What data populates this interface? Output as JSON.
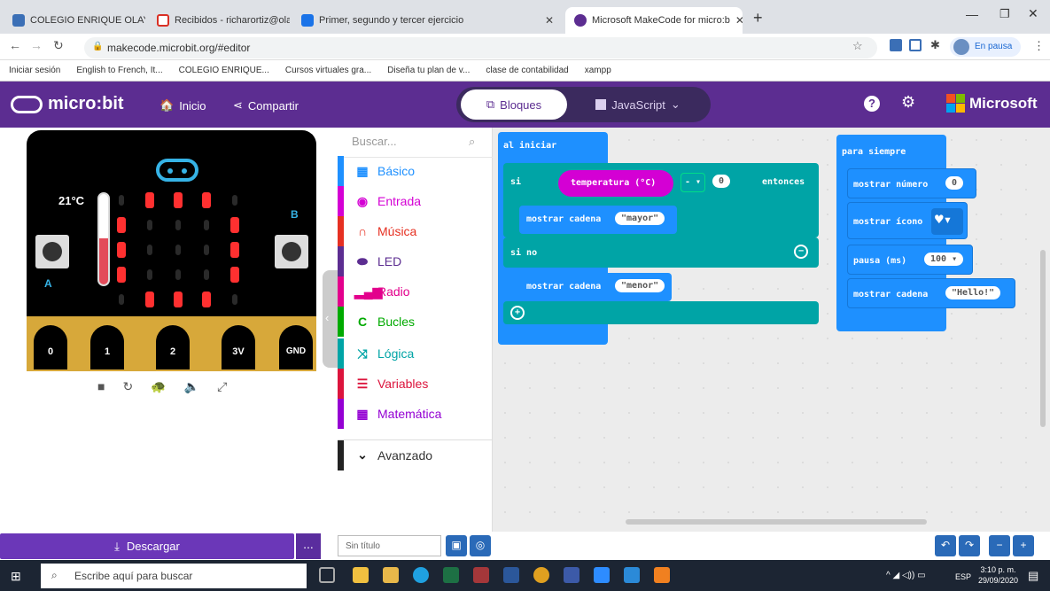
{
  "browser": {
    "tabs": [
      {
        "title": "COLEGIO ENRIQUE OLAYA HERR",
        "color": "#3b6fb6"
      },
      {
        "title": "Recibidos - richarortiz@olayista.",
        "color": "#d93025"
      },
      {
        "title": "Primer, segundo y tercer ejercicio",
        "color": "#1a73e8"
      },
      {
        "title": "Microsoft MakeCode for micro:b",
        "color": "#5c2d91"
      }
    ],
    "new_tab": "+",
    "url": "makecode.microbit.org/#editor",
    "profile": "En pausa",
    "bookmarks": [
      "Iniciar sesión",
      "English to French, It...",
      "COLEGIO ENRIQUE...",
      "Cursos virtuales gra...",
      "Diseña tu plan de v...",
      "clase de contabilidad",
      "xampp"
    ]
  },
  "header": {
    "logo": "micro:bit",
    "home": "Inicio",
    "share": "Compartir",
    "blocks": "Bloques",
    "javascript": "JavaScript",
    "brand": "Microsoft"
  },
  "simulator": {
    "temp": "21°C",
    "pins": [
      "0",
      "1",
      "2",
      "3V",
      "GND"
    ],
    "button_a": "A",
    "button_b": "B"
  },
  "toolbox": {
    "search_placeholder": "Buscar...",
    "categories": [
      {
        "label": "Básico",
        "color": "#1e90ff"
      },
      {
        "label": "Entrada",
        "color": "#d400d4"
      },
      {
        "label": "Música",
        "color": "#e63022"
      },
      {
        "label": "LED",
        "color": "#5c2d91"
      },
      {
        "label": "Radio",
        "color": "#e3008c"
      },
      {
        "label": "Bucles",
        "color": "#00aa00"
      },
      {
        "label": "Lógica",
        "color": "#00a4a6"
      },
      {
        "label": "Variables",
        "color": "#dc143c"
      },
      {
        "label": "Matemática",
        "color": "#9400d3"
      }
    ],
    "advanced": "Avanzado"
  },
  "workspace": {
    "on_start": {
      "label": "al iniciar",
      "if": "si",
      "condition": "temperatura (°C)",
      "operator": "- ▾",
      "value": "0",
      "then": "entonces",
      "show_string_1": "mostrar cadena",
      "str1": "mayor",
      "else": "si no",
      "show_string_2": "mostrar cadena",
      "str2": "menor"
    },
    "forever": {
      "label": "para siempre",
      "show_number": "mostrar número",
      "num": "0",
      "show_icon": "mostrar ícono",
      "pause": "pausa (ms)",
      "pause_val": "100",
      "show_string": "mostrar cadena",
      "str": "Hello!"
    }
  },
  "bottom": {
    "download": "Descargar",
    "more": "...",
    "project_name": "Sin título"
  },
  "taskbar": {
    "search": "Escribe aquí para buscar",
    "time": "3:10 p. m.",
    "date": "29/09/2020",
    "lang": "ESP"
  }
}
